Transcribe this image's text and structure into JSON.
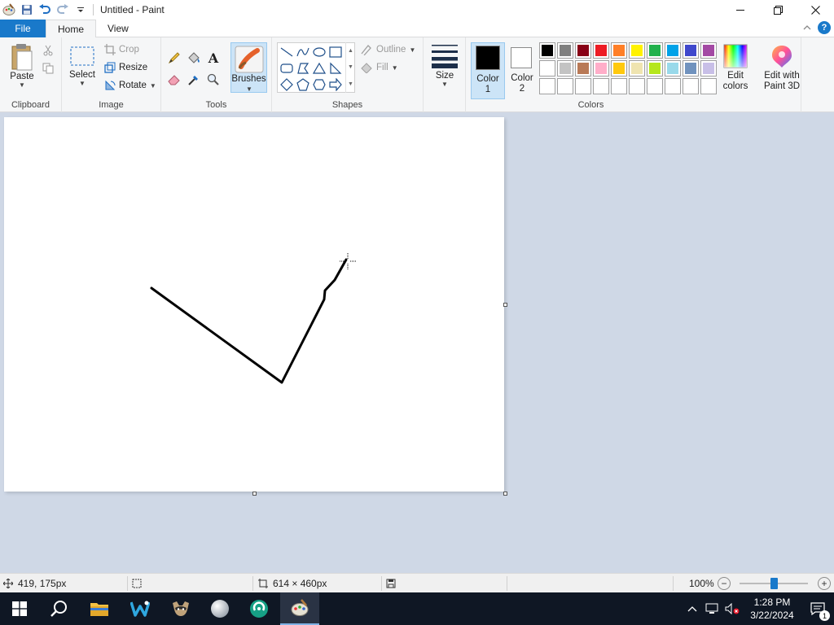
{
  "window": {
    "title": "Untitled - Paint",
    "minimize_icon": "minimize-icon",
    "maximize_icon": "restore-icon",
    "close_icon": "close-icon"
  },
  "tabs": [
    {
      "label": "File"
    },
    {
      "label": "Home"
    },
    {
      "label": "View"
    }
  ],
  "ribbon": {
    "clipboard": {
      "group_label": "Clipboard",
      "paste": "Paste"
    },
    "image": {
      "group_label": "Image",
      "select": "Select",
      "crop": "Crop",
      "resize": "Resize",
      "rotate": "Rotate"
    },
    "tools": {
      "group_label": "Tools",
      "brushes": "Brushes"
    },
    "shapes": {
      "group_label": "Shapes",
      "outline": "Outline",
      "fill": "Fill"
    },
    "size": {
      "label": "Size"
    },
    "colors": {
      "group_label": "Colors",
      "color1_line1": "Color",
      "color1_line2": "1",
      "color2_line1": "Color",
      "color2_line2": "2",
      "color1_value": "#000000",
      "color2_value": "#ffffff",
      "edit_colors_line1": "Edit",
      "edit_colors_line2": "colors",
      "paint3d_line1": "Edit with",
      "paint3d_line2": "Paint 3D",
      "palette_row1": [
        "#000000",
        "#7f7f7f",
        "#880015",
        "#ed1c24",
        "#ff7f27",
        "#fff200",
        "#22b14c",
        "#00a2e8",
        "#3f48cc",
        "#a349a4"
      ],
      "palette_row2": [
        "#ffffff",
        "#c3c3c3",
        "#b97a57",
        "#ffaec9",
        "#ffc90e",
        "#efe4b0",
        "#b5e61d",
        "#99d9ea",
        "#7092be",
        "#c8bfe7"
      ],
      "palette_row3": [
        "#ffffff",
        "#ffffff",
        "#ffffff",
        "#ffffff",
        "#ffffff",
        "#ffffff",
        "#ffffff",
        "#ffffff",
        "#ffffff",
        "#ffffff"
      ]
    }
  },
  "status": {
    "cursor_position": "419, 175px",
    "image_size": "614 × 460px",
    "zoom": "100%"
  },
  "taskbar": {
    "time": "1:28 PM",
    "date": "3/22/2024",
    "notification_count": "1"
  }
}
